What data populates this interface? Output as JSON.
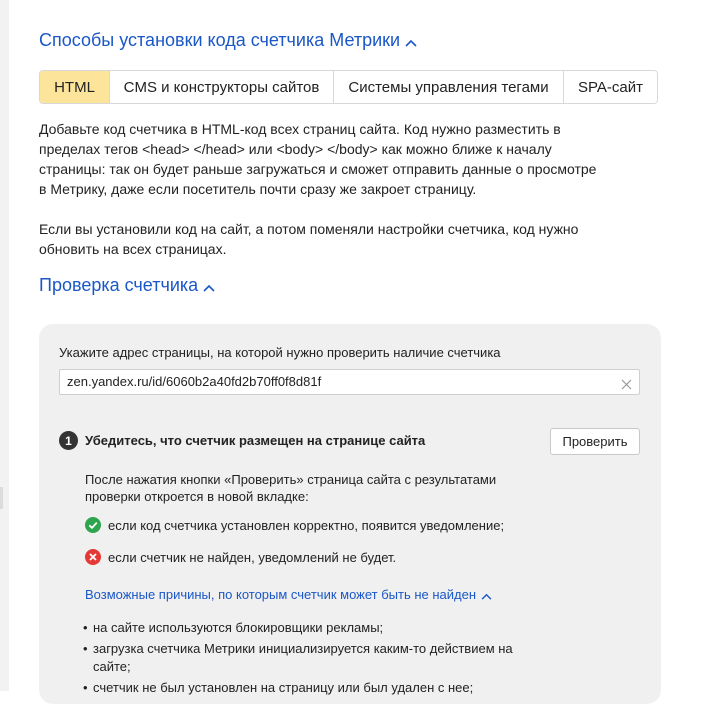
{
  "install": {
    "title": "Способы установки кода счетчика Метрики",
    "tabs": [
      {
        "label": "HTML",
        "active": true
      },
      {
        "label": "CMS и конструкторы сайтов",
        "active": false
      },
      {
        "label": "Системы управления тегами",
        "active": false
      },
      {
        "label": "SPA-сайт",
        "active": false
      }
    ],
    "paragraph1": "Добавьте код счетчика в HTML-код всех страниц сайта. Код нужно разместить в пределах тегов <head> </head> или <body> </body> как можно ближе к началу страницы: так он будет раньше загружаться и сможет отправить данные о просмотре в Метрику, даже если посетитель почти сразу же закроет страницу.",
    "paragraph2": "Если вы установили код на сайт, а потом поменяли настройки счетчика, код нужно обновить на всех страницах."
  },
  "check": {
    "title": "Проверка счетчика",
    "url_label": "Укажите адрес страницы, на которой нужно проверить наличие счетчика",
    "url_value": "zen.yandex.ru/id/6060b2a40fd2b70ff0f8d81f",
    "step_number": "1",
    "step_title": "Убедитесь, что счетчик размещен на странице сайта",
    "check_button": "Проверить",
    "step_description": "После нажатия кнопки «Проверить» страница сайта с результатами проверки откроется в новой вкладке:",
    "success_text": "если код счетчика установлен корректно, появится уведомление;",
    "fail_text": "если счетчик не найден, уведомлений не будет.",
    "reasons_link": "Возможные причины, по которым счетчик может быть не найден",
    "reasons": [
      "на сайте используются блокировщики рекламы;",
      "загрузка счетчика Метрики инициализируется каким-то действием на сайте;",
      "счетчик не был установлен на страницу или был удален с нее;"
    ]
  },
  "colors": {
    "accent": "#1a57c7",
    "active_tab": "#fde49b",
    "success": "#2ea44f",
    "error": "#e53935",
    "panel": "#f0f0f0"
  },
  "icons": {
    "collapse": "chevron-up-icon",
    "clear": "close-icon",
    "success": "check-circle-icon",
    "error": "cross-circle-icon"
  }
}
